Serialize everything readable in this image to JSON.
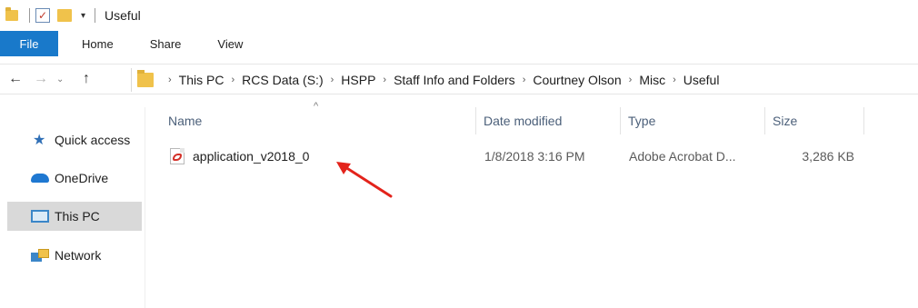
{
  "window": {
    "title": "Useful"
  },
  "ribbon": {
    "tabs": [
      "File",
      "Home",
      "Share",
      "View"
    ]
  },
  "address": {
    "crumbs": [
      "This PC",
      "RCS Data (S:)",
      "HSPP",
      "Staff Info and Folders",
      "Courtney Olson",
      "Misc",
      "Useful"
    ]
  },
  "sidebar": {
    "items": [
      {
        "label": "Quick access",
        "icon": "star-icon"
      },
      {
        "label": "OneDrive",
        "icon": "cloud-icon"
      },
      {
        "label": "This PC",
        "icon": "computer-icon",
        "selected": true
      },
      {
        "label": "Network",
        "icon": "network-icon"
      }
    ]
  },
  "columns": {
    "name": "Name",
    "date": "Date modified",
    "type": "Type",
    "size": "Size"
  },
  "files": [
    {
      "name": "application_v2018_0",
      "date": "1/8/2018 3:16 PM",
      "type": "Adobe Acrobat D...",
      "size": "3,286 KB",
      "icon": "pdf-icon"
    }
  ],
  "colors": {
    "file_tab": "#1979ca",
    "accent_arrow": "#e3231b",
    "selected_bg": "#d9d9d9"
  }
}
